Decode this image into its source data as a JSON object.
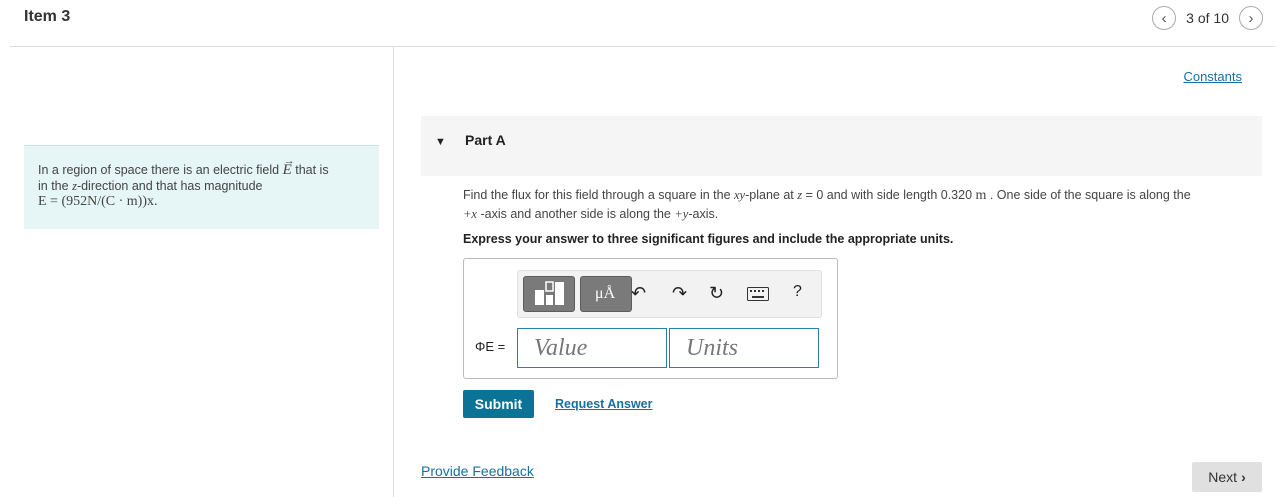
{
  "header": {
    "item_title": "Item 3",
    "pager_text": "3 of 10"
  },
  "context": {
    "line1_a": "In a region of space there is an electric field ",
    "line1_b": "E",
    "line1_c": " that is",
    "line2_a": "in the ",
    "line2_b": "z",
    "line2_c": "-direction and that has magnitude",
    "line3": "E = (952N/(C · m))x."
  },
  "constants_link": "Constants",
  "part": {
    "title": "Part A"
  },
  "question": {
    "text_a": "Find the flux for this field through a square in the ",
    "xy": "xy",
    "text_b": "-plane at ",
    "z": "z",
    "text_c": " = 0 and with side length 0.320 ",
    "unit": "m",
    "text_d": " . One side of the square is along the",
    "text_e": "+x",
    "text_f": " -axis and another side is along the ",
    "text_g": "+y",
    "text_h": "-axis."
  },
  "instruction": "Express your answer to three significant figures and include the appropriate units.",
  "answer": {
    "label": "ΦE =",
    "value_placeholder": "Value",
    "units_placeholder": "Units",
    "toolbar": {
      "templates": "templates-icon",
      "units_tool": "μÅ",
      "help": "?"
    }
  },
  "buttons": {
    "submit": "Submit",
    "request_answer": "Request Answer",
    "next": "Next"
  },
  "footer": {
    "feedback": "Provide Feedback"
  }
}
